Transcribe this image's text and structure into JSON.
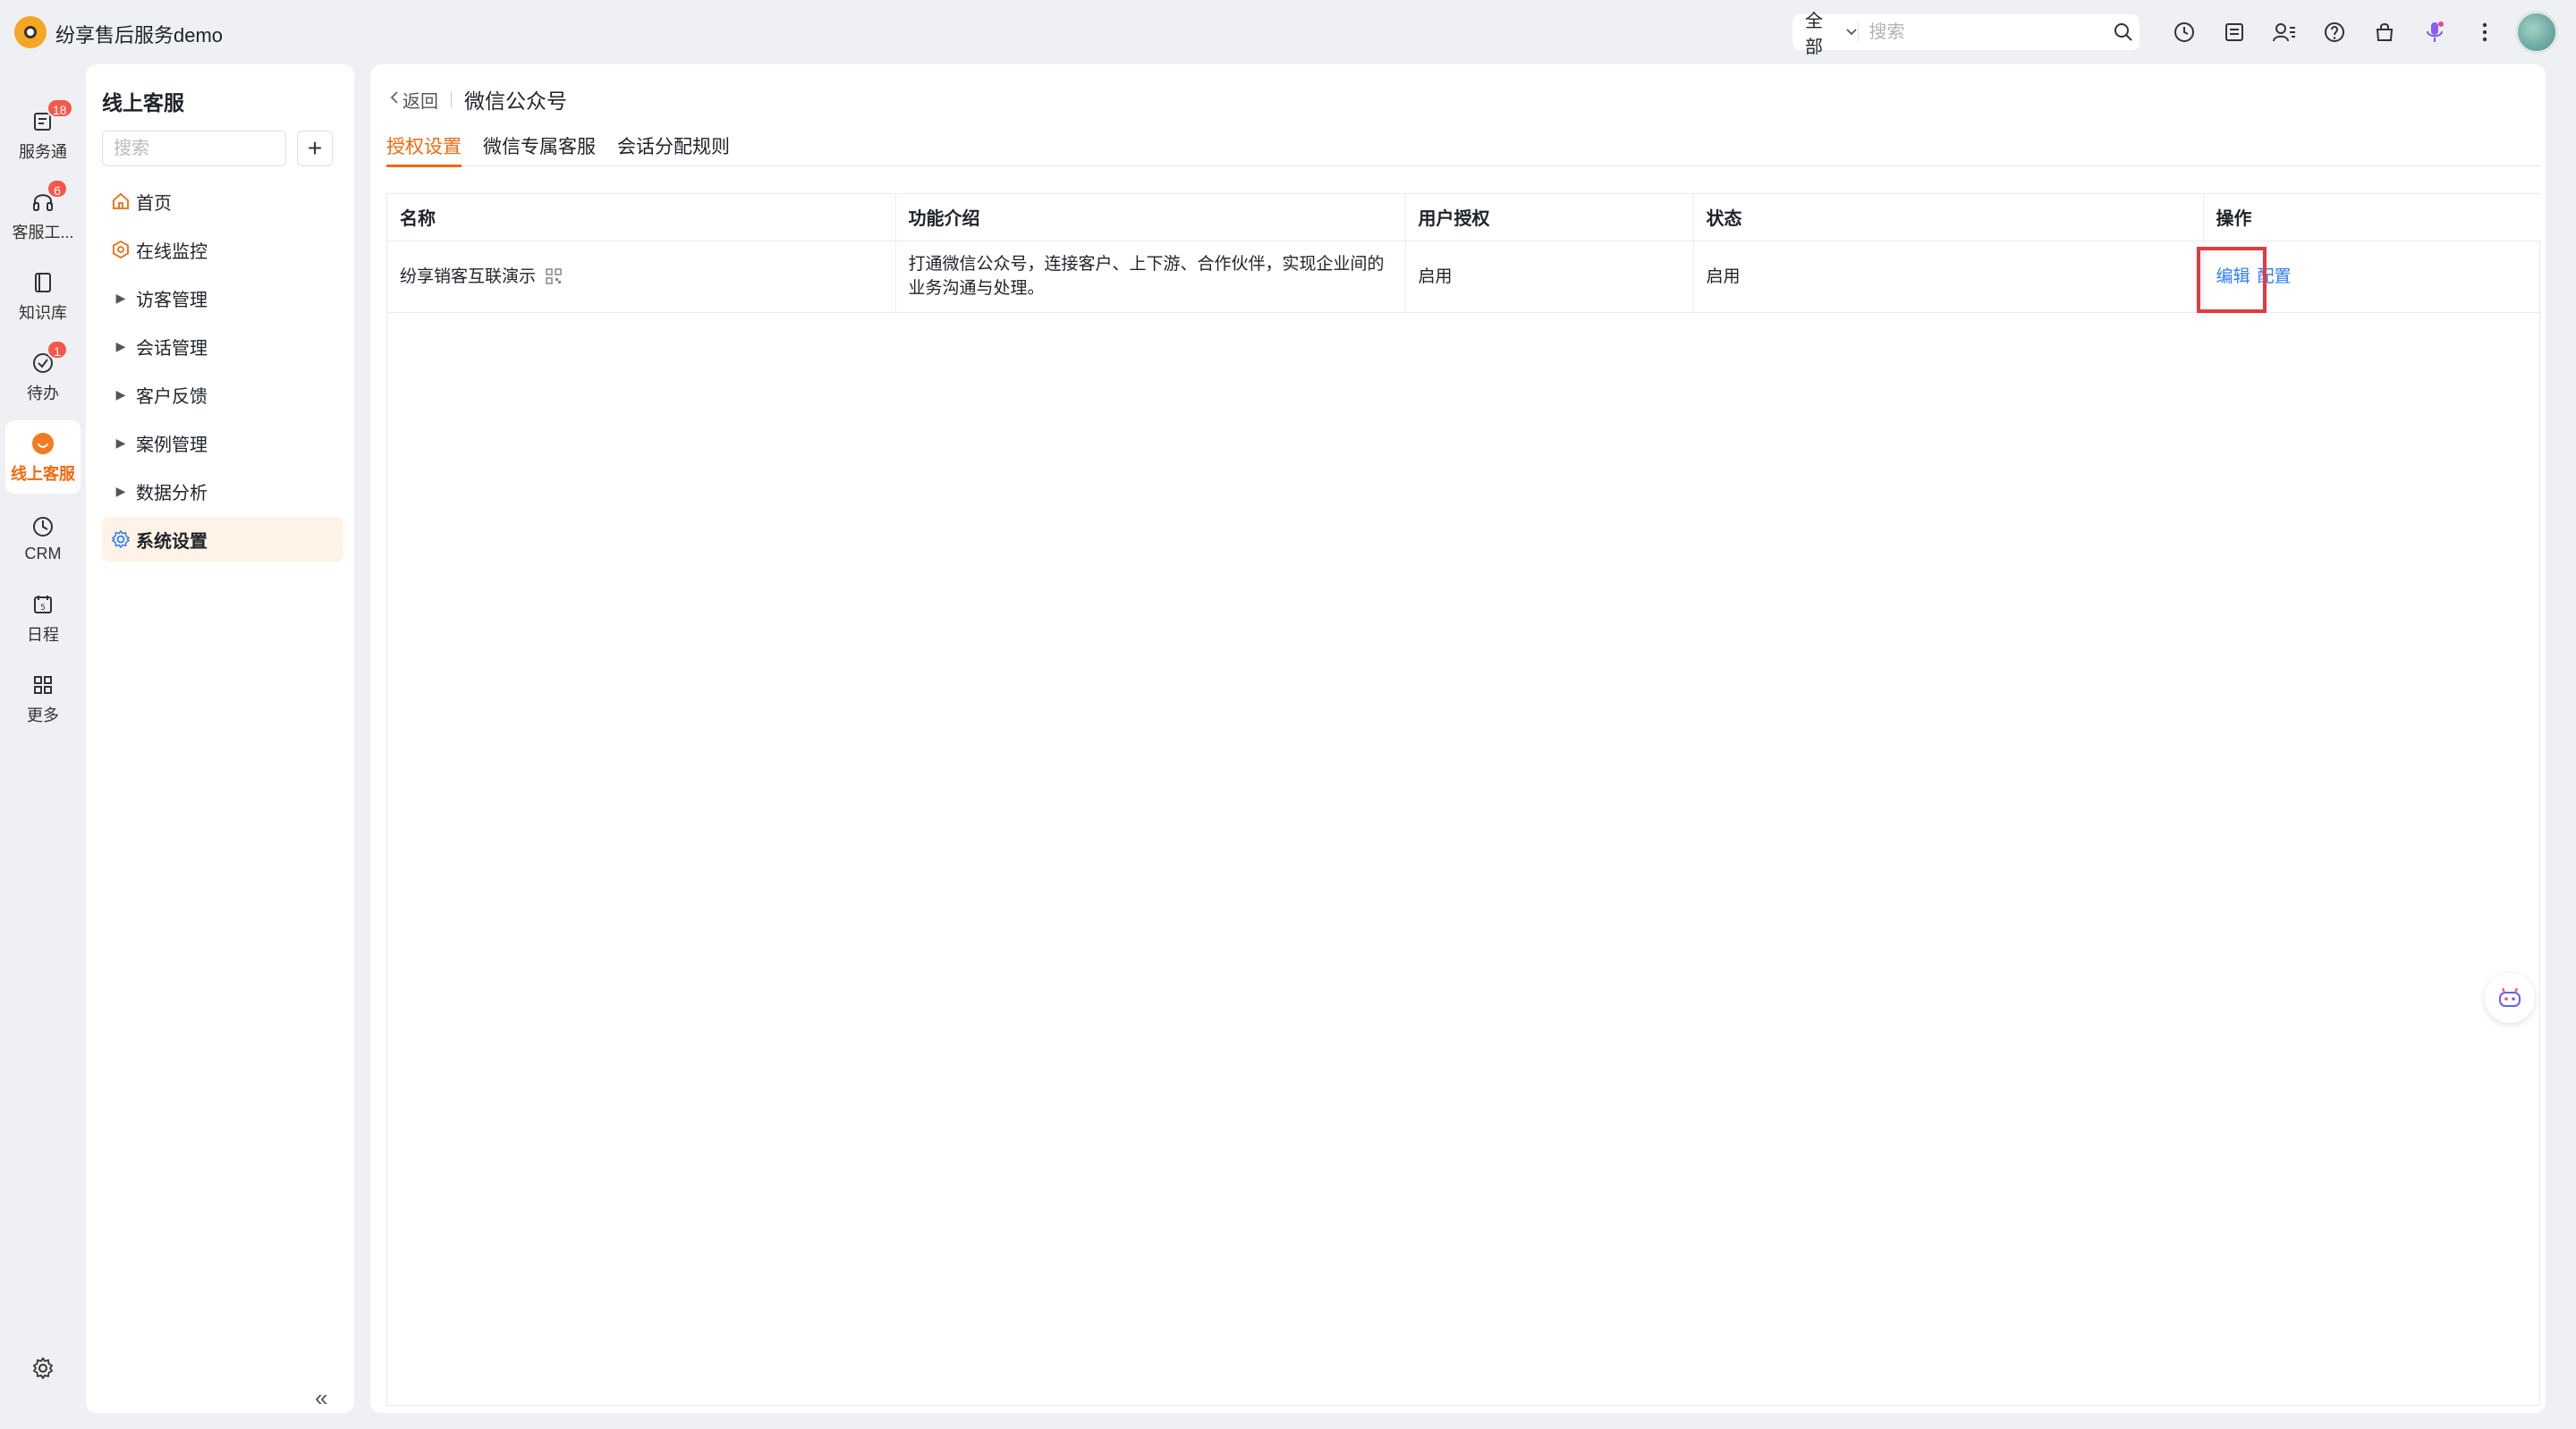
{
  "app": {
    "title": "纷享售后服务demo"
  },
  "topbar": {
    "search_scope": "全部",
    "search_placeholder": "搜索",
    "icons": [
      "clock-icon",
      "inbox-icon",
      "contacts-icon",
      "help-icon",
      "store-icon",
      "voice-assistant-icon",
      "more-icon"
    ]
  },
  "rail": {
    "items": [
      {
        "label": "服务通",
        "icon": "service-icon",
        "badge": "18"
      },
      {
        "label": "客服工...",
        "icon": "headset-icon",
        "badge": "6"
      },
      {
        "label": "知识库",
        "icon": "book-icon",
        "badge": ""
      },
      {
        "label": "待办",
        "icon": "check-circle-icon",
        "badge": "1"
      },
      {
        "label": "线上客服",
        "icon": "online-service-icon",
        "badge": "",
        "active": true
      },
      {
        "label": "CRM",
        "icon": "crm-icon",
        "badge": ""
      },
      {
        "label": "日程",
        "icon": "calendar-icon",
        "badge": ""
      },
      {
        "label": "更多",
        "icon": "grid-icon",
        "badge": ""
      }
    ]
  },
  "sidebar": {
    "title": "线上客服",
    "search_placeholder": "搜索",
    "add_label": "+",
    "items": [
      {
        "label": "首页",
        "icon": "home-icon"
      },
      {
        "label": "在线监控",
        "icon": "monitor-icon"
      },
      {
        "label": "访客管理",
        "icon": "caret-right-icon"
      },
      {
        "label": "会话管理",
        "icon": "caret-right-icon"
      },
      {
        "label": "客户反馈",
        "icon": "caret-right-icon"
      },
      {
        "label": "案例管理",
        "icon": "caret-right-icon"
      },
      {
        "label": "数据分析",
        "icon": "caret-right-icon"
      },
      {
        "label": "系统设置",
        "icon": "gear-icon",
        "active": true
      }
    ],
    "collapse_label": "«"
  },
  "main": {
    "back_label": "返回",
    "page_title": "微信公众号",
    "tabs": [
      {
        "label": "授权设置",
        "active": true
      },
      {
        "label": "微信专属客服"
      },
      {
        "label": "会话分配规则"
      }
    ],
    "table": {
      "columns": [
        "名称",
        "功能介绍",
        "用户授权",
        "状态",
        "操作"
      ],
      "rows": [
        {
          "name": "纷享销客互联演示",
          "description": "打通微信公众号，连接客户、上下游、合作伙伴，实现企业间的业务沟通与处理。",
          "user_auth": "启用",
          "status": "启用",
          "actions": [
            "编辑",
            "配置"
          ]
        }
      ]
    }
  },
  "colors": {
    "accent": "#f06a0f",
    "link": "#2f7cf6",
    "badge": "#f5584a",
    "highlight": "#e8383d"
  }
}
